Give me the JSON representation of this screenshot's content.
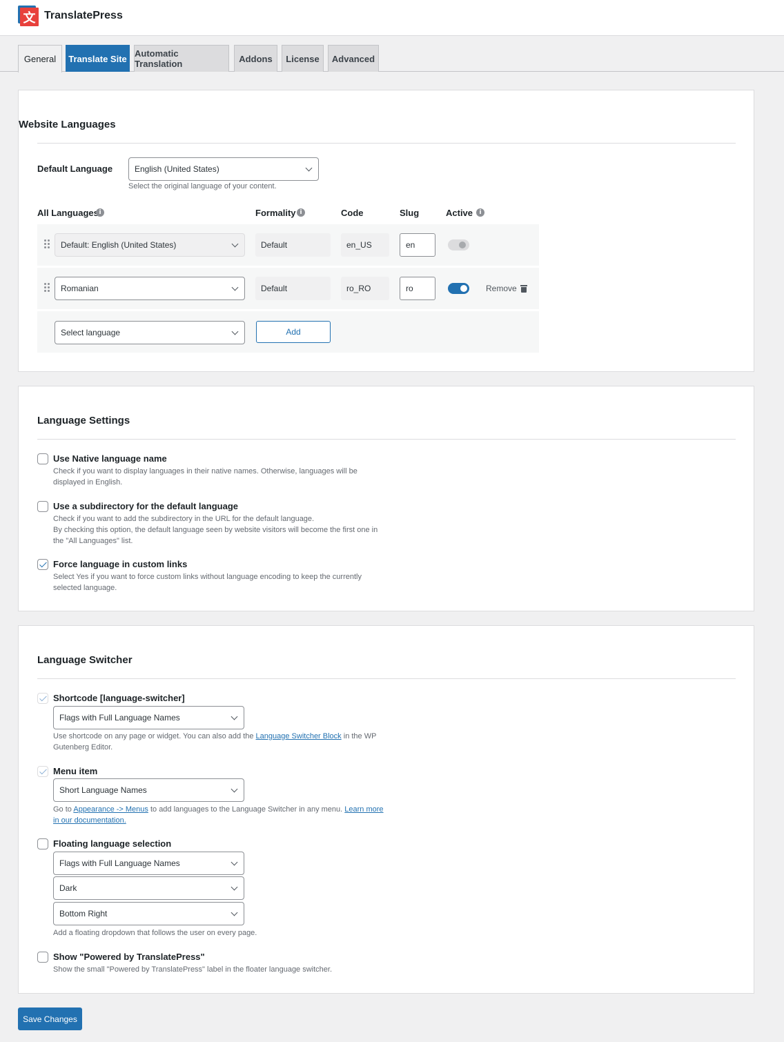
{
  "brand": {
    "name": "TranslatePress",
    "logo_glyph": "文"
  },
  "tabs": [
    {
      "label": "General"
    },
    {
      "label": "Translate Site"
    },
    {
      "label": "Automatic Translation"
    },
    {
      "label": "Addons"
    },
    {
      "label": "License"
    },
    {
      "label": "Advanced"
    }
  ],
  "website_languages": {
    "title": "Website Languages",
    "default_language": {
      "label": "Default Language",
      "value": "English (United States)",
      "description": "Select the original language of your content."
    },
    "headers": {
      "all_languages": "All Languages",
      "formality": "Formality",
      "code": "Code",
      "slug": "Slug",
      "active": "Active"
    },
    "rows": [
      {
        "language": "Default: English (United States)",
        "formality": "Default",
        "code": "en_US",
        "slug": "en",
        "active": true
      },
      {
        "language": "Romanian",
        "formality": "Default",
        "code": "ro_RO",
        "slug": "ro",
        "active": true,
        "remove_label": "Remove"
      }
    ],
    "add_row": {
      "placeholder": "Select language",
      "button": "Add"
    }
  },
  "language_settings": {
    "title": "Language Settings",
    "options": [
      {
        "label": "Use Native language name",
        "checked": false,
        "desc": [
          "Check if you want to display languages in their native names. Otherwise, languages will be",
          "displayed in English."
        ]
      },
      {
        "label": "Use a subdirectory for the default language",
        "checked": false,
        "desc": [
          "Check if you want to add the subdirectory in the URL for the default language.",
          "By checking this option, the default language seen by website visitors will become the first one in",
          "the \"All Languages\" list."
        ]
      },
      {
        "label": "Force language in custom links",
        "checked": true,
        "desc": [
          "Select Yes if you want to force custom links without language encoding to keep the currently",
          "selected language."
        ]
      }
    ]
  },
  "language_switcher": {
    "title": "Language Switcher",
    "shortcode": {
      "label": "Shortcode [language-switcher]",
      "checked": true,
      "select": "Flags with Full Language Names",
      "desc_pre": "Use shortcode on any page or widget. You can also add the ",
      "desc_link": "Language Switcher Block",
      "desc_post": " in the WP",
      "desc_line2": "Gutenberg Editor."
    },
    "menu_item": {
      "label": "Menu item",
      "checked": true,
      "select": "Short Language Names",
      "desc_pre": "Go to ",
      "desc_link1": "Appearance -> Menus",
      "desc_mid": " to add languages to the Language Switcher in any menu. ",
      "desc_link2": "Learn more",
      "desc_link3": "in our documentation."
    },
    "floating": {
      "label": "Floating language selection",
      "checked": false,
      "select1": "Flags with Full Language Names",
      "select2": "Dark",
      "select3": "Bottom Right",
      "desc": "Add a floating dropdown that follows the user on every page."
    },
    "powered_by": {
      "label": "Show \"Powered by TranslatePress\"",
      "checked": false,
      "desc": "Show the small \"Powered by TranslatePress\" label in the floater language switcher."
    }
  },
  "save_button": "Save Changes"
}
